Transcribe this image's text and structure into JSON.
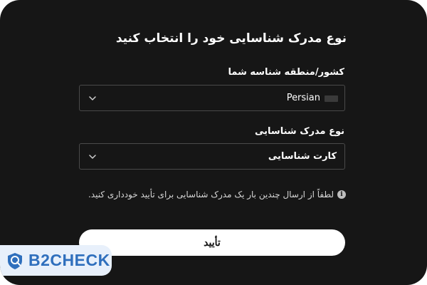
{
  "dialog": {
    "title": "نوع مدرک شناسایی خود را انتخاب کنید",
    "country_field": {
      "label": "کشور/منطقه شناسه شما",
      "value": "Persian",
      "flag_icon": "flag-icon",
      "dropdown_icon": "chevron-down-icon"
    },
    "doctype_field": {
      "label": "نوع مدرک شناسایی",
      "value": "کارت شناسایی",
      "dropdown_icon": "chevron-down-icon"
    },
    "info": {
      "icon": "info-icon",
      "glyph": "i",
      "text": "لطفاً از ارسال چندین بار یک مدرک شناسایی برای تأیید خودداری کنید."
    },
    "confirm_label": "تأیید"
  },
  "watermark": {
    "text": "B2CHECK",
    "icon": "shield-logo-icon"
  },
  "colors": {
    "background": "#161616",
    "border": "#4a4a4a",
    "button_bg": "#ffffff",
    "watermark_blue": "#2f6fbd",
    "watermark_bg": "#e8f0fb"
  }
}
